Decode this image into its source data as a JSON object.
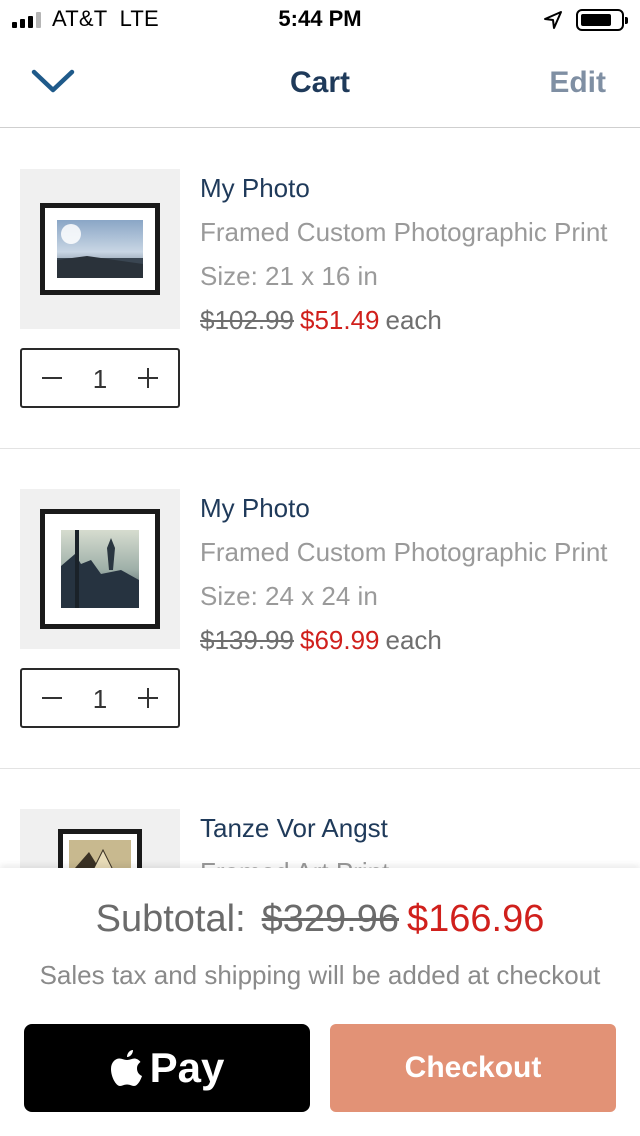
{
  "status_bar": {
    "carrier": "AT&T  LTE",
    "time": "5:44 PM"
  },
  "nav": {
    "title": "Cart",
    "edit_label": "Edit"
  },
  "items": [
    {
      "name": "My Photo",
      "description": "Framed Custom Photographic Print",
      "size": "Size: 21 x 16 in",
      "original_price": "$102.99",
      "sale_price": "$51.49",
      "each_label": "each",
      "quantity": "1"
    },
    {
      "name": "My Photo",
      "description": "Framed Custom Photographic Print",
      "size": "Size: 24 x 24 in",
      "original_price": "$139.99",
      "sale_price": "$69.99",
      "each_label": "each",
      "quantity": "1"
    },
    {
      "name": "Tanze Vor Angst",
      "description": "Framed Art Print"
    }
  ],
  "footer": {
    "subtotal_label": "Subtotal:",
    "subtotal_original": "$329.96",
    "subtotal_sale": "$166.96",
    "tax_note": "Sales tax and shipping will be added at checkout",
    "apple_pay_label": "Pay",
    "checkout_label": "Checkout"
  },
  "colors": {
    "navy": "#1f3a5a",
    "sale_red": "#d0201c",
    "checkout_bg": "#e29276",
    "edit_gray": "#7f8fa3"
  },
  "icons": [
    "signal-icon",
    "location-arrow-icon",
    "battery-icon",
    "chevron-down-icon",
    "minus-icon",
    "plus-icon",
    "apple-logo-icon"
  ]
}
